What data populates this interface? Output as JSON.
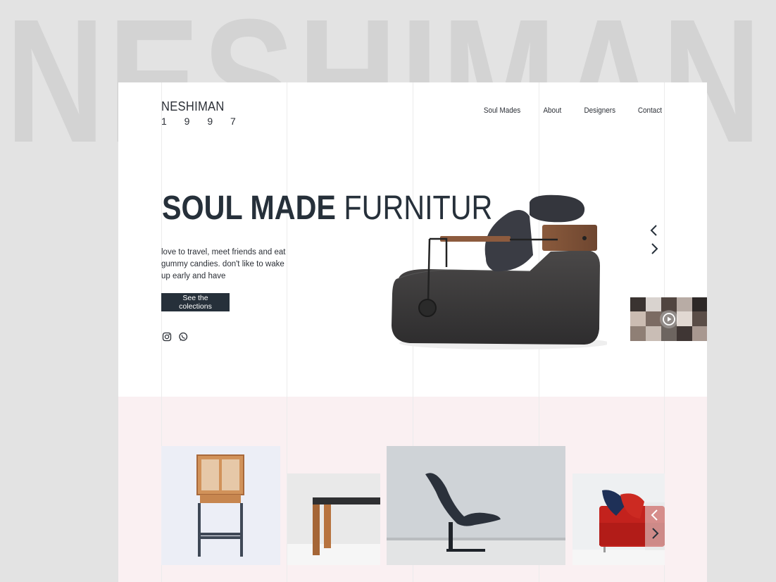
{
  "background_word": "NESHIMAN",
  "logo": {
    "name": "NESHIMAN",
    "year": "1 9 9 7"
  },
  "nav": [
    "Soul Mades",
    "About",
    "Designers",
    "Contact"
  ],
  "hero": {
    "title_bold": "SOUL MADE",
    "title_light": "FURNITUR",
    "description": "love to travel, meet friends and eat gummy candies. don't like to wake up early and have",
    "cta": "See the colections"
  },
  "icons": [
    "instagram-icon",
    "whatsapp-icon",
    "chevron-left-icon",
    "chevron-right-icon",
    "play-icon"
  ],
  "colors": {
    "dark": "#26303a",
    "pink_band": "#faf0f2",
    "bg": "#e3e3e3"
  }
}
